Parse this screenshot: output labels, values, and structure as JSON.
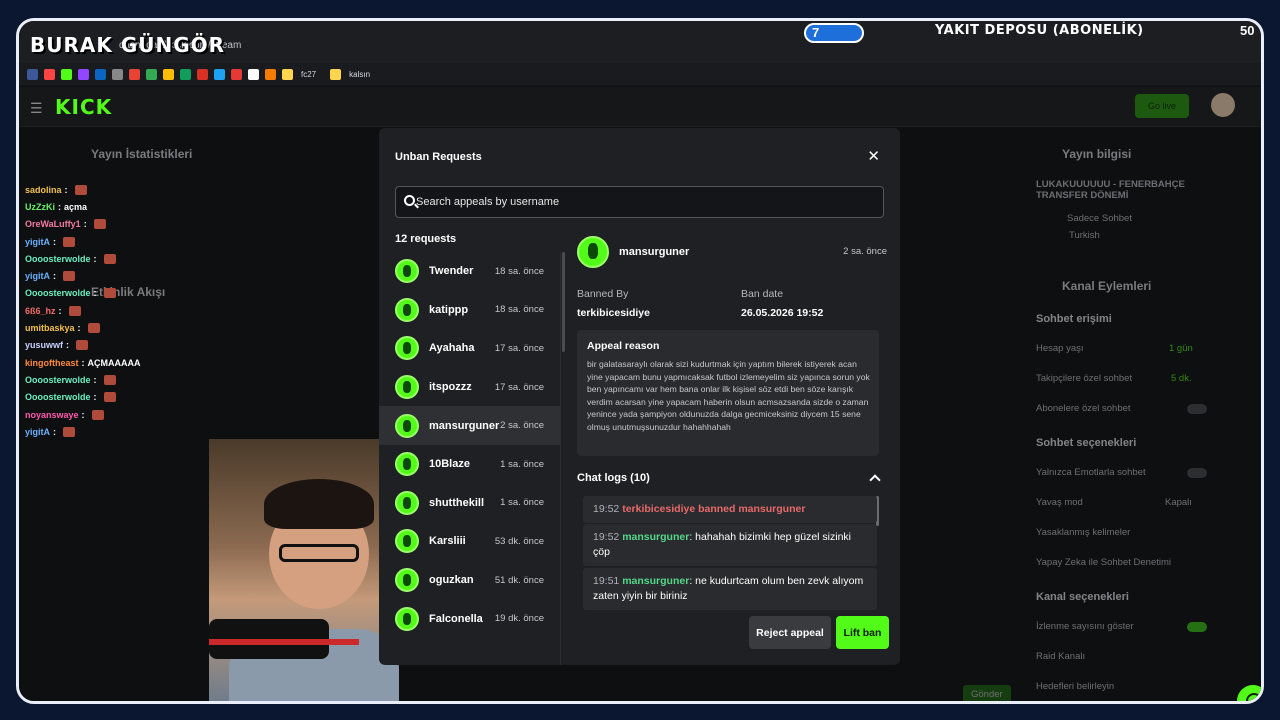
{
  "browser": {
    "url": "dashboard.kick.com/stream",
    "bookmarks": [
      "fc27",
      "kalsın"
    ]
  },
  "overlay": {
    "logo": "BURAK GÜNGÖR",
    "banner_num": "7",
    "banner_text": "YAKIT DEPOSU (ABONELİK)",
    "banner_count": "50"
  },
  "kick": {
    "logo": "KICK",
    "go_live": "Go live"
  },
  "background": {
    "stats_title": "Yayın İstatistikleri",
    "activity_title": "Etkinlik Akışı",
    "stream_info": "Yayın bilgisi",
    "stream_sub": "LUKAKUUUUUU - FENERBAHÇE TRANSFER DÖNEMİ",
    "stream_cat": "Sadece Sohbet",
    "stream_lang": "Turkish",
    "channel_actions": "Kanal Eylemleri",
    "chat_access": "Sohbet erişimi",
    "acc_age": "Hesap yaşı",
    "acc_age_val": "1 gün",
    "followers_only": "Takipçilere özel sohbet",
    "followers_val": "5 dk.",
    "subs_only": "Abonelere özel sohbet",
    "chat_options": "Sohbet seçenekleri",
    "emote_only": "Yalnızca Emotlarla sohbet",
    "slow_mode": "Yavaş mod",
    "slow_val": "Kapalı",
    "banned_words": "Yasaklanmış kelimeler",
    "ai_mod": "Yapay Zeka ile Sohbet Denetimi",
    "channel_options": "Kanal seçenekleri",
    "show_views": "İzlenme sayısını göster",
    "raid": "Raid Kanalı",
    "targets": "Hedefleri belirleyin",
    "send": "Gönder"
  },
  "chat": [
    {
      "user": "sadolina",
      "color": "#f2c14e",
      "msg": ""
    },
    {
      "user": "UzZzKi",
      "color": "#6af06a",
      "msg": "açma"
    },
    {
      "user": "OreWaLuffy1",
      "color": "#f47aa0",
      "msg": ""
    },
    {
      "user": "yigitA",
      "color": "#6ab0ff",
      "msg": ""
    },
    {
      "user": "Oooosterwolde",
      "color": "#6af0c0",
      "msg": ""
    },
    {
      "user": "yigitA",
      "color": "#6ab0ff",
      "msg": ""
    },
    {
      "user": "Oooosterwolde",
      "color": "#6af0c0",
      "msg": ""
    },
    {
      "user": "6ß6_hz",
      "color": "#f46a6a",
      "msg": ""
    },
    {
      "user": "umitbaskya",
      "color": "#f2c14e",
      "msg": ""
    },
    {
      "user": "yusuwwf",
      "color": "#c9d0ff",
      "msg": ""
    },
    {
      "user": "kingoftheast",
      "color": "#ff8a3d",
      "msg": "AÇMAAAAA"
    },
    {
      "user": "Oooosterwolde",
      "color": "#6af0c0",
      "msg": ""
    },
    {
      "user": "Oooosterwolde",
      "color": "#6af0c0",
      "msg": ""
    },
    {
      "user": "noyanswaye",
      "color": "#ff5ab0",
      "msg": ""
    },
    {
      "user": "yigitA",
      "color": "#6ab0ff",
      "msg": ""
    }
  ],
  "modal": {
    "title": "Unban Requests",
    "search_placeholder": "Search appeals by username",
    "count": "12 requests",
    "requests": [
      {
        "name": "Twender",
        "time": "18 sa. önce"
      },
      {
        "name": "katippp",
        "time": "18 sa. önce"
      },
      {
        "name": "Ayahaha",
        "time": "17 sa. önce"
      },
      {
        "name": "itspozzz",
        "time": "17 sa. önce"
      },
      {
        "name": "mansurguner",
        "time": "2 sa. önce"
      },
      {
        "name": "10Blaze",
        "time": "1 sa. önce"
      },
      {
        "name": "shutthekill",
        "time": "1 sa. önce"
      },
      {
        "name": "Karsliii",
        "time": "53 dk. önce"
      },
      {
        "name": "oguzkan",
        "time": "51 dk. önce"
      },
      {
        "name": "Falconella",
        "time": "19 dk. önce"
      }
    ],
    "detail": {
      "name": "mansurguner",
      "time": "2 sa. önce",
      "banned_by_label": "Banned By",
      "banned_by": "terkibicesidiye",
      "ban_date_label": "Ban date",
      "ban_date": "26.05.2026 19:52",
      "reason_title": "Appeal reason",
      "reason": "bir galatasaraylı olarak sizi kudurtmak için yaptım bilerek istiyerek acan yine yapacam bunu yapmıcaksak futbol izlemeyelim siz yapınca sorun yok ben yapıncamı var hem bana onlar ilk kişisel söz etdi ben söze karışık verdim acarsan yine yapacam haberin olsun acmsazsanda sizde o zaman yenince yada şampiyon oldunuzda dalga gecmiceksiniz diycem 15 sene olmuş unutmuşsunuzdur hahahhahah",
      "chat_logs_title": "Chat logs (10)",
      "logs": [
        {
          "time": "19:52",
          "text": "terkibicesidiye banned mansurguner"
        },
        {
          "time": "19:52",
          "user": "mansurguner",
          "text": "hahahah bizimki hep güzel sizinki çöp"
        },
        {
          "time": "19:51",
          "user": "mansurguner",
          "text": "ne kudurtcam olum ben zevk alıyom zaten yiyin bir biriniz"
        }
      ],
      "reject": "Reject appeal",
      "lift": "Lift ban"
    }
  }
}
